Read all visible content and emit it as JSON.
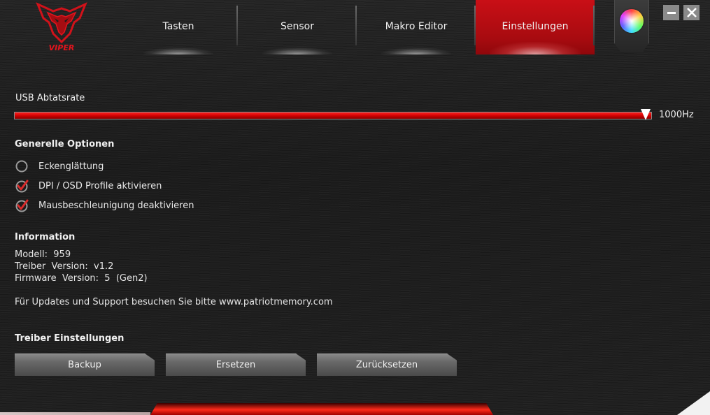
{
  "app": {
    "logo_text": "VIPER"
  },
  "tabs": [
    {
      "label": "Tasten",
      "active": false
    },
    {
      "label": "Sensor",
      "active": false
    },
    {
      "label": "Makro Editor",
      "active": false
    },
    {
      "label": "Einstellungen",
      "active": true
    }
  ],
  "window": {
    "minimize_icon": "minimize-icon",
    "close_icon": "close-icon",
    "color_icon": "color-wheel-icon"
  },
  "usb": {
    "label": "USB Abtatsrate",
    "value_label": "1000Hz",
    "level": 1.0
  },
  "general_options": {
    "heading": "Generelle Optionen",
    "items": [
      {
        "label": "Eckenglättung",
        "checked": false
      },
      {
        "label": "DPI / OSD Profile aktivieren",
        "checked": true
      },
      {
        "label": "Mausbeschleunigung deaktivieren",
        "checked": true
      }
    ]
  },
  "information": {
    "heading": "Information",
    "model": "Modell:  959",
    "driver": "Treiber  Version:  v1.2",
    "firmware": "Firmware  Version:  5  (Gen2)",
    "support": "Für Updates und Support besuchen Sie bitte www.patriotmemory.com"
  },
  "driver_settings": {
    "heading": "Treiber Einstellungen",
    "backup_label": "Backup",
    "replace_label": "Ersetzen",
    "reset_label": "Zurücksetzen"
  },
  "colors": {
    "accent": "#c90f16",
    "check": "#d92b2b"
  }
}
